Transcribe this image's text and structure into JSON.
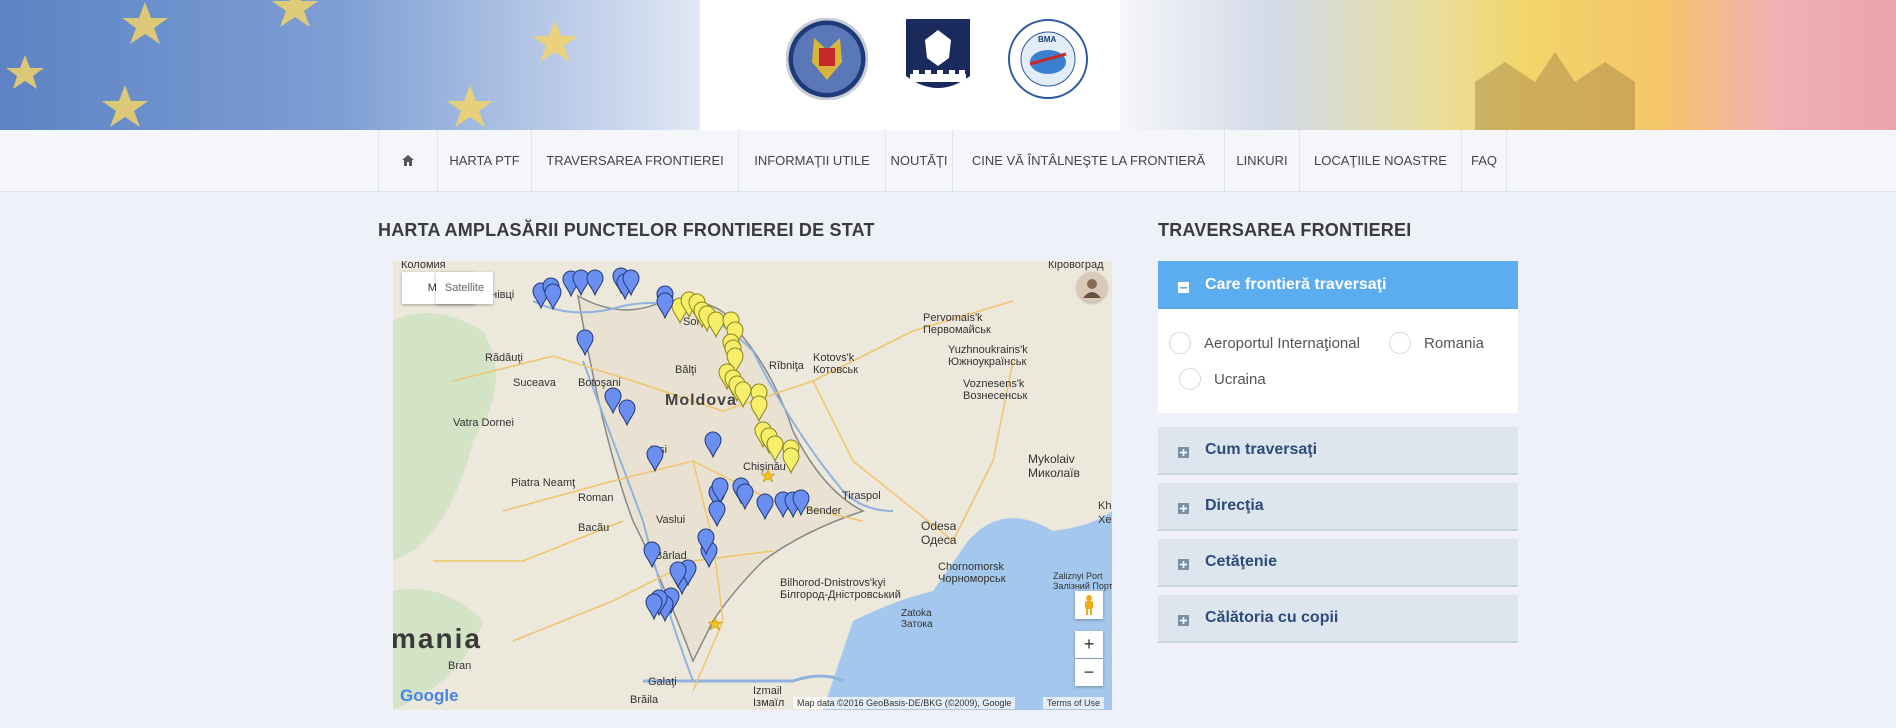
{
  "nav": {
    "items": [
      {
        "label": "HARTA PTF"
      },
      {
        "label": "TRAVERSAREA FRONTIEREI"
      },
      {
        "label": "INFORMAŢII UTILE"
      },
      {
        "label": "NOUTĂŢI"
      },
      {
        "label": "CINE VĂ ÎNTÂLNEŞTE LA FRONTIERĂ"
      },
      {
        "label": "LINKURI"
      },
      {
        "label": "LOCAŢIILE NOASTRE"
      },
      {
        "label": "FAQ"
      }
    ]
  },
  "logos": {
    "bma": "BMA"
  },
  "map_section": {
    "title": "HARTA AMPLASĂRII PUNCTELOR FRONTIEREI DE STAT"
  },
  "map": {
    "type_map": "Map",
    "type_satellite": "Satellite",
    "zoom_in": "+",
    "zoom_out": "−",
    "attribution": "Map data ©2016 GeoBasis-DE/BKG (©2009), Google",
    "terms": "Terms of Use",
    "google": "Google",
    "labels": {
      "kolomyia": "Коломия",
      "chernivtsi": "рнівці",
      "soroca": "Soroca",
      "radauti": "Rădăuţi",
      "balti": "Bălţi",
      "suceava": "Suceava",
      "botosani": "Botoşani",
      "moldova": "Moldova",
      "vatra": "Vatra Dornei",
      "iasi": "Iaşi",
      "piatra": "Piatra Neamţ",
      "roman": "Roman",
      "vaslui": "Vaslui",
      "bacau": "Bacău",
      "barlad": "Bârlad",
      "chisinau": "Chişinău",
      "bender": "Bender",
      "tiraspol": "Tiraspol",
      "ribnita": "Rîbniţa",
      "kotovsk1": "Kotovs'k",
      "kotovsk2": "Котовськ",
      "kirovohrad": "Кіровоград",
      "pervomaisk1": "Pervomais'k",
      "pervomaisk2": "Первомайськ",
      "yuzhno1": "Yuzhnoukrains'k",
      "yuzhno2": "Южноукраїнськ",
      "voznes1": "Voznesens'k",
      "voznes2": "Вознесенськ",
      "mykolaiv1": "Mykolaiv",
      "mykolaiv2": "Миколаїв",
      "odesa1": "Odesa",
      "odesa2": "Одеса",
      "kherson": "Khe",
      "kherson2": "Хер",
      "bilhorod1": "Bilhorod-Dnistrovs'kyi",
      "bilhorod2": "Білгород-Дністровський",
      "chorno1": "Chornomorsk",
      "chorno2": "Чорноморськ",
      "zaliznyi1": "Zaliznyi Port",
      "zaliznyi2": "Залізний Порт",
      "zatoka1": "Zatoka",
      "zatoka2": "Затока",
      "romania": "mania",
      "bran": "Bran",
      "galati": "Galaţi",
      "braila": "Brăila",
      "izmail1": "Izmail",
      "izmail2": "Ізмаїл"
    }
  },
  "traverse": {
    "title": "TRAVERSAREA FRONTIEREI",
    "panels": [
      {
        "label": "Care frontieră traversaţi"
      },
      {
        "label": "Cum traversaţi"
      },
      {
        "label": "Direcţia"
      },
      {
        "label": "Cetăţenie"
      },
      {
        "label": "Călătoria cu copii"
      }
    ],
    "options": [
      {
        "label": "Aeroportul Internaţional"
      },
      {
        "label": "Romania"
      },
      {
        "label": "Ucraina"
      }
    ]
  }
}
